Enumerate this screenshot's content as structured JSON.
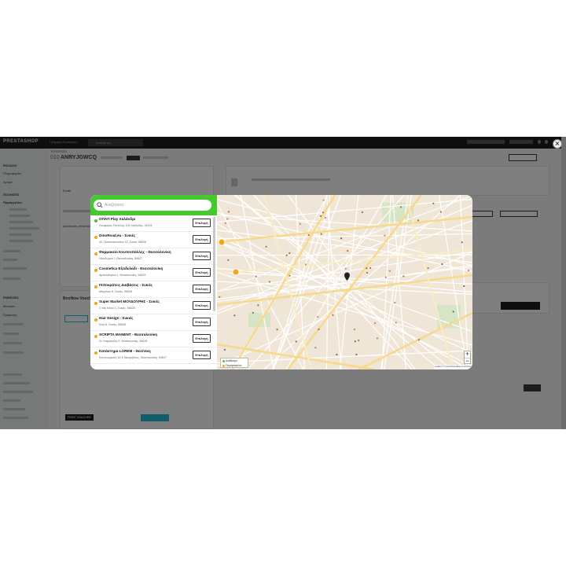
{
  "app": {
    "logo": "PRESTASHOP",
    "quick_access": "Γρήγορη Πρόσβαση",
    "search_placeholder": "Αναζήτηση"
  },
  "sidebar": {
    "sections": [
      {
        "head": "ΕΙΣΟΔΟΣ",
        "items": [
          "Πληροφορίες",
          "Αγορά"
        ]
      },
      {
        "head": "ΠΩΛΗΣΕΙΣ",
        "items": [
          "Παραγγελίες"
        ]
      },
      {
        "head": "ΕΝΘΕΣΕΙΣ",
        "items": [
          "Modules",
          "Εμφάνιση"
        ]
      }
    ]
  },
  "order": {
    "prefix": "010",
    "reference": "ANRYJGWCQ",
    "customer_label": "Email",
    "shipping_label": "Διεύθυνση αποστολής",
    "section_label": "BoxNow Voucher",
    "print_button": "PRINT VOUCHER"
  },
  "modal": {
    "search_placeholder": "Αναζήτηση",
    "select_label": "Επιλογή",
    "items": [
      {
        "name": "OΠΑΠ Play Χαλάνδρι",
        "address": "Λεωφόρος Πεντέλης 125 Χαλάνδρι, 15234",
        "status_color": "#46c92f"
      },
      {
        "name": "DinoRoad.eu - Συκιές",
        "address": "42, Παπαναστασίου 12, Συκιές 56626",
        "status_color": "#f2a51a"
      },
      {
        "name": "Φαρμακείο Κουτσοπάλλης - Θεσσαλονίκη",
        "address": "Ηλιοδώρου 1 Θεσσαλονίκη, 54627",
        "status_color": "#f2a51a"
      },
      {
        "name": "Cosmetica Εξειδυλαδι - Θεσσαλονίκη",
        "address": "Αμπελόκηποι 2, Θεσσαλονίκη, 54629",
        "status_color": "#f2a51a"
      },
      {
        "name": "Ιπποκράτεις Διαβάσεις - Συκιές",
        "address": "Μαγγίνας 8, Συκιές, 56626",
        "status_color": "#f2a51a"
      },
      {
        "name": "Super Market ΜΟΥΔΟΥΡΗΣ - Συκιές",
        "address": "Σ τίτα Ντίου 1, Συκιές, 56625",
        "status_color": "#f2a51a"
      },
      {
        "name": "Hair Design - Συκιές",
        "address": "Ελιά 8, Συκιές, 56626",
        "status_color": "#f2a51a"
      },
      {
        "name": "SCRIPTA MANENT - Θεσσαλονίκη",
        "address": "Στ. Καρυκάλλη 9, Θεσσαλονίκη, 56628",
        "status_color": "#f2a51a"
      },
      {
        "name": "Κατάστημα LOREM - Θεσ/νίκη",
        "address": "Κουντουριώτη 16 & Νικομήδους, Θεσσαλονίκη, 54627",
        "status_color": "#f2a51a"
      }
    ],
    "legend": [
      {
        "label": "Διαθέσιμο",
        "color": "#46c92f"
      },
      {
        "label": "Περιορισμένο",
        "color": "#f2a51a"
      }
    ],
    "attribution": "Leaflet | © OpenStreetMap contributors"
  }
}
